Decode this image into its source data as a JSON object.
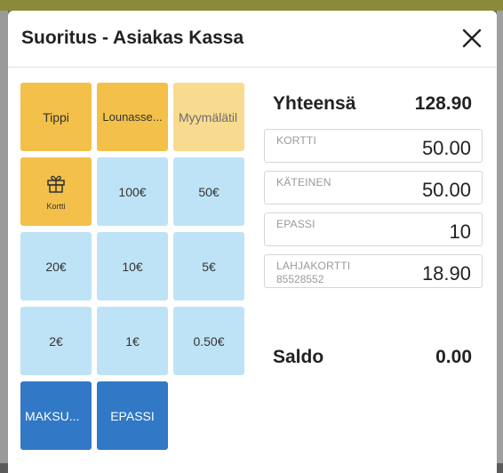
{
  "dialog": {
    "title": "Suoritus - Asiakas Kassa"
  },
  "keys": {
    "tippi": "Tippi",
    "lounas": "Lounasse...",
    "myymala": "Myymälätil",
    "gift_sub": "Kortti",
    "k100": "100€",
    "k50": "50€",
    "k20": "20€",
    "k10": "10€",
    "k5": "5€",
    "k2": "2€",
    "k1": "1€",
    "k050": "0.50€",
    "maksu": "MAKSU...",
    "epassi": "EPASSI"
  },
  "summary": {
    "total_label": "Yhteensä",
    "total_value": "128.90",
    "saldo_label": "Saldo",
    "saldo_value": "0.00"
  },
  "payments": [
    {
      "label": "KORTTI",
      "sub": "",
      "value": "50.00"
    },
    {
      "label": "KÄTEINEN",
      "sub": "",
      "value": "50.00"
    },
    {
      "label": "EPASSI",
      "sub": "",
      "value": "10"
    },
    {
      "label": "LAHJAKORTTI",
      "sub": "85528552",
      "value": "18.90"
    }
  ],
  "colors": {
    "yellow": "#f3c04a",
    "light_yellow": "#f8db8f",
    "light_blue": "#bfe3f6",
    "dark_blue": "#3178c6"
  },
  "icons": {
    "close": "close-icon",
    "gift": "gift-icon"
  }
}
